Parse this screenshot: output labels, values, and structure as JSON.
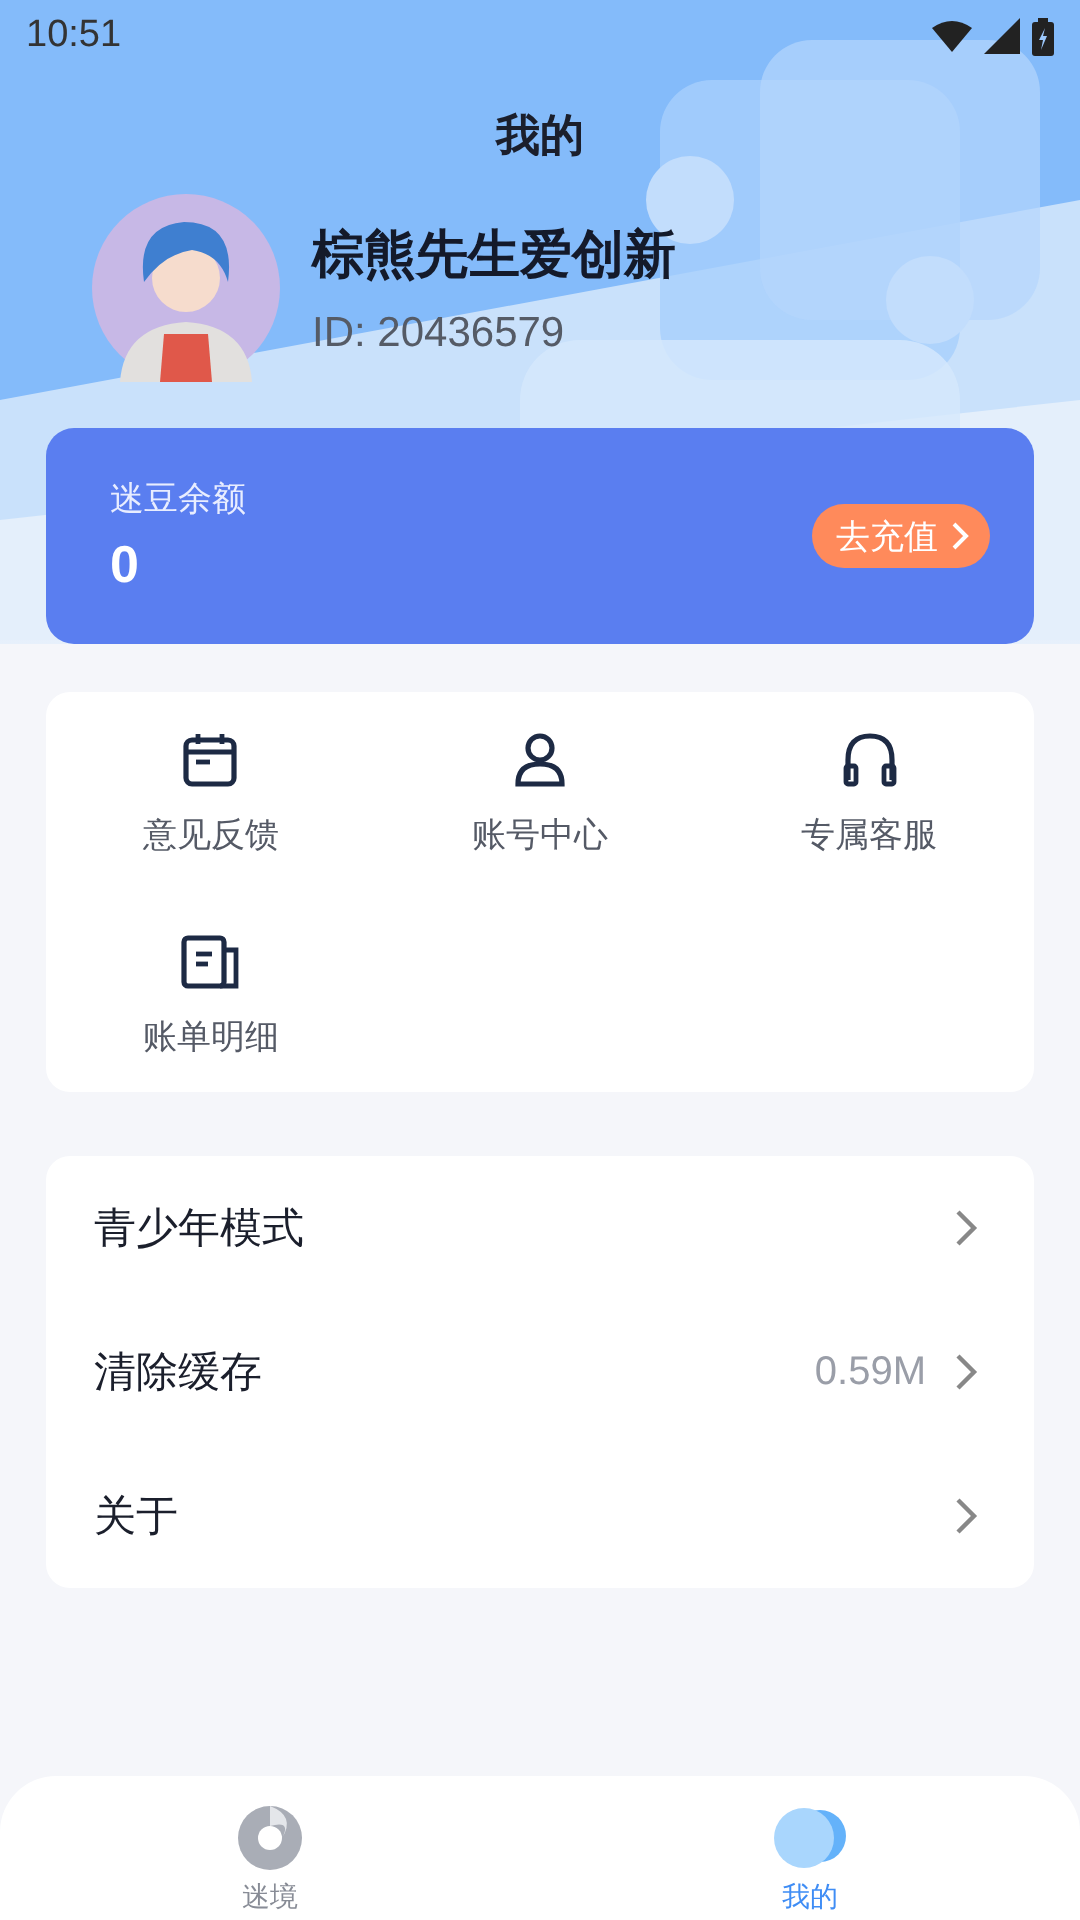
{
  "status_bar": {
    "time": "10:51"
  },
  "header": {
    "title": "我的"
  },
  "profile": {
    "name": "棕熊先生爱创新",
    "id": "ID: 20436579"
  },
  "balance": {
    "label": "迷豆余额",
    "amount": "0",
    "button": "去充值"
  },
  "shortcuts": [
    {
      "kind": "calendar",
      "label": "意见反馈"
    },
    {
      "kind": "person",
      "label": "账号中心"
    },
    {
      "kind": "headset",
      "label": "专属客服"
    },
    {
      "kind": "bill",
      "label": "账单明细"
    }
  ],
  "settings": [
    {
      "label": "青少年模式"
    },
    {
      "label": "清除缓存",
      "value": "0.59M"
    },
    {
      "label": "关于"
    }
  ],
  "tab_bar": [
    {
      "kind": "swirl",
      "label": "迷境",
      "selected": false
    },
    {
      "kind": "blob",
      "label": "我的",
      "selected": true
    }
  ]
}
